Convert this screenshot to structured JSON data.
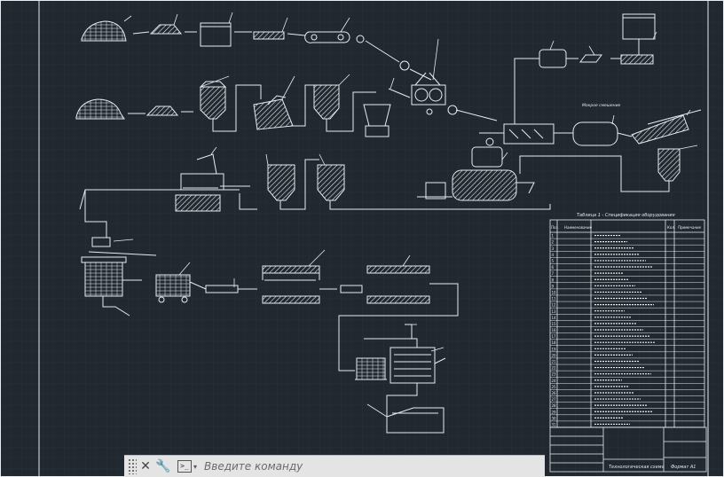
{
  "app": {
    "command_line": {
      "placeholder": "Введите команду",
      "close_icon": "close-icon",
      "customize_icon": "wrench-icon",
      "prompt_icon": "command-prompt-icon",
      "prompt_glyph": ">_"
    }
  },
  "drawing": {
    "table_title": "Таблица 1 - Спецификация оборудования",
    "table_headers": [
      "Поз.",
      "Наименование",
      "Кол.",
      "Примечание"
    ],
    "table_left_codes": [
      "1",
      "2",
      "3",
      "4",
      "5",
      "6",
      "7",
      "8",
      "9",
      "10",
      "11",
      "12",
      "13",
      "14",
      "15",
      "16",
      "17",
      "18",
      "19",
      "20",
      "21",
      "22",
      "23",
      "24",
      "25",
      "26",
      "27",
      "28",
      "29",
      "30",
      "31"
    ],
    "title_block_main": "Технологическая схема",
    "title_block_format": "Формат А1",
    "note_top": "Мокрое смешение"
  },
  "colors": {
    "background": "#212830",
    "lines": "#e8ecef",
    "grid": "#2c343d"
  }
}
